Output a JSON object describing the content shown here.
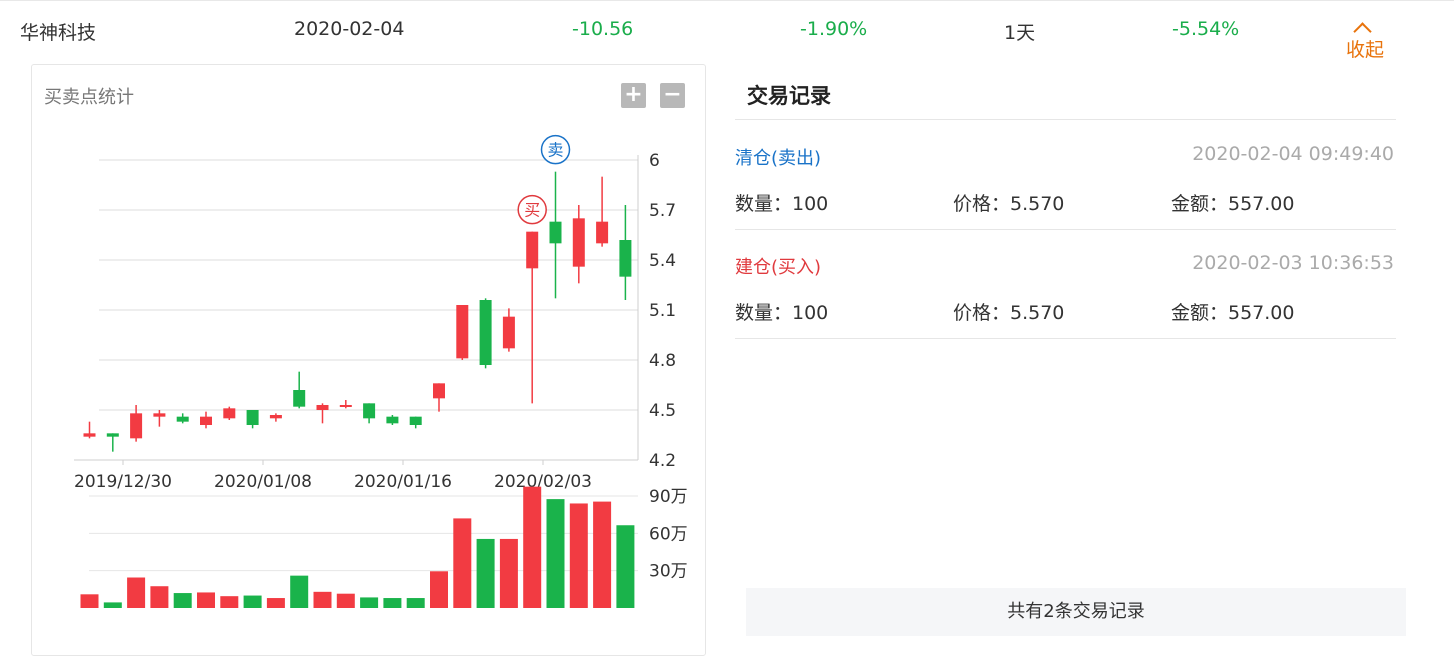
{
  "summary": {
    "name": "华神科技",
    "date": "2020-02-04",
    "profit": "-10.56",
    "profit_pct": "-1.90%",
    "hold_days": "1天",
    "change_pct": "-5.54%",
    "collapse_label": "收起"
  },
  "chart": {
    "title": "买卖点统计",
    "zoom_in": "+",
    "zoom_out": "−",
    "buy_marker": "买",
    "sell_marker": "卖"
  },
  "trades": {
    "title": "交易记录",
    "records": [
      {
        "type": "清仓(卖出)",
        "time": "2020-02-04 09:49:40",
        "qty": "数量：100",
        "price": "价格：5.570",
        "amount": "金额：557.00"
      },
      {
        "type": "建仓(买入)",
        "time": "2020-02-03 10:36:53",
        "qty": "数量：100",
        "price": "价格：5.570",
        "amount": "金额：557.00"
      }
    ],
    "footer": "共有2条交易记录"
  },
  "colors": {
    "up": "#f23b42",
    "down": "#1ab34b",
    "sell": "#1a73c8",
    "buy": "#e03a3e",
    "accent": "#e8730c"
  },
  "chart_data": {
    "type": "candlestick",
    "price_axis": {
      "ticks": [
        6,
        5.7,
        5.4,
        5.1,
        4.8,
        4.5,
        4.2
      ],
      "ylim": [
        4.2,
        6
      ]
    },
    "x_tick_labels": [
      "2019/12/30",
      "2020/01/08",
      "2020/01/16",
      "2020/02/03"
    ],
    "volume_axis": {
      "ticks": [
        "90万",
        "60万",
        "30万"
      ],
      "ylim": [
        0,
        900000
      ]
    },
    "candles": [
      {
        "o": 4.36,
        "c": 4.34,
        "h": 4.43,
        "l": 4.33,
        "dir": "up"
      },
      {
        "o": 4.36,
        "c": 4.34,
        "h": 4.36,
        "l": 4.25,
        "dir": "down"
      },
      {
        "o": 4.33,
        "c": 4.48,
        "h": 4.53,
        "l": 4.31,
        "dir": "up"
      },
      {
        "o": 4.46,
        "c": 4.48,
        "h": 4.5,
        "l": 4.4,
        "dir": "up"
      },
      {
        "o": 4.46,
        "c": 4.43,
        "h": 4.48,
        "l": 4.42,
        "dir": "down"
      },
      {
        "o": 4.41,
        "c": 4.46,
        "h": 4.49,
        "l": 4.39,
        "dir": "up"
      },
      {
        "o": 4.45,
        "c": 4.51,
        "h": 4.52,
        "l": 4.44,
        "dir": "up"
      },
      {
        "o": 4.5,
        "c": 4.41,
        "h": 4.5,
        "l": 4.39,
        "dir": "down"
      },
      {
        "o": 4.45,
        "c": 4.47,
        "h": 4.48,
        "l": 4.43,
        "dir": "up"
      },
      {
        "o": 4.52,
        "c": 4.62,
        "h": 4.73,
        "l": 4.51,
        "dir": "down"
      },
      {
        "o": 4.5,
        "c": 4.53,
        "h": 4.54,
        "l": 4.42,
        "dir": "up"
      },
      {
        "o": 4.52,
        "c": 4.53,
        "h": 4.56,
        "l": 4.51,
        "dir": "up"
      },
      {
        "o": 4.54,
        "c": 4.45,
        "h": 4.54,
        "l": 4.42,
        "dir": "down"
      },
      {
        "o": 4.46,
        "c": 4.42,
        "h": 4.47,
        "l": 4.41,
        "dir": "down"
      },
      {
        "o": 4.46,
        "c": 4.41,
        "h": 4.46,
        "l": 4.39,
        "dir": "down"
      },
      {
        "o": 4.57,
        "c": 4.66,
        "h": 4.66,
        "l": 4.49,
        "dir": "up"
      },
      {
        "o": 4.81,
        "c": 5.13,
        "h": 5.13,
        "l": 4.8,
        "dir": "up"
      },
      {
        "o": 5.16,
        "c": 4.77,
        "h": 5.17,
        "l": 4.75,
        "dir": "down"
      },
      {
        "o": 4.87,
        "c": 5.06,
        "h": 5.11,
        "l": 4.85,
        "dir": "up"
      },
      {
        "o": 5.35,
        "c": 5.57,
        "h": 5.57,
        "l": 4.54,
        "dir": "up"
      },
      {
        "o": 5.63,
        "c": 5.5,
        "h": 5.93,
        "l": 5.17,
        "dir": "down"
      },
      {
        "o": 5.36,
        "c": 5.65,
        "h": 5.73,
        "l": 5.26,
        "dir": "up"
      },
      {
        "o": 5.5,
        "c": 5.63,
        "h": 5.9,
        "l": 5.48,
        "dir": "up"
      },
      {
        "o": 5.52,
        "c": 5.3,
        "h": 5.73,
        "l": 5.16,
        "dir": "down"
      }
    ],
    "volumes": [
      110000,
      45000,
      245000,
      175000,
      120000,
      125000,
      95000,
      100000,
      80000,
      260000,
      130000,
      115000,
      85000,
      80000,
      80000,
      295000,
      720000,
      555000,
      555000,
      975000,
      875000,
      840000,
      855000,
      665000
    ],
    "markers": [
      {
        "label": "买",
        "index": 19,
        "price": 5.57
      },
      {
        "label": "卖",
        "index": 20,
        "price": 5.93
      }
    ]
  }
}
